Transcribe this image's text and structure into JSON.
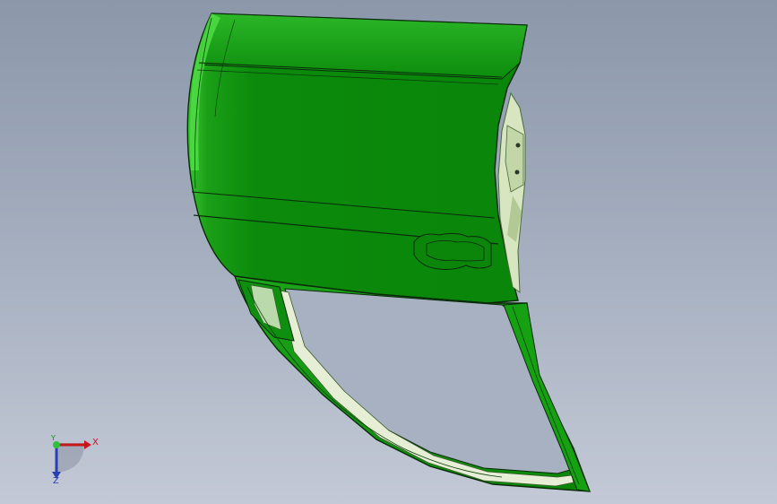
{
  "viewport": {
    "background_top": "#8c97aa",
    "background_bottom": "#c3c9d6"
  },
  "model": {
    "part": "car-door-panel",
    "body_color": "#0d8a0d",
    "highlight_color": "#3fcf3a",
    "edge_color": "#0a2a0a",
    "inner_trim_color": "#d9e6c4"
  },
  "triad": {
    "x_label": "X",
    "y_label": "Y",
    "z_label": "Z",
    "x_color": "#c8161d",
    "y_color": "#1f8c2a",
    "z_color": "#2a3fb0"
  }
}
